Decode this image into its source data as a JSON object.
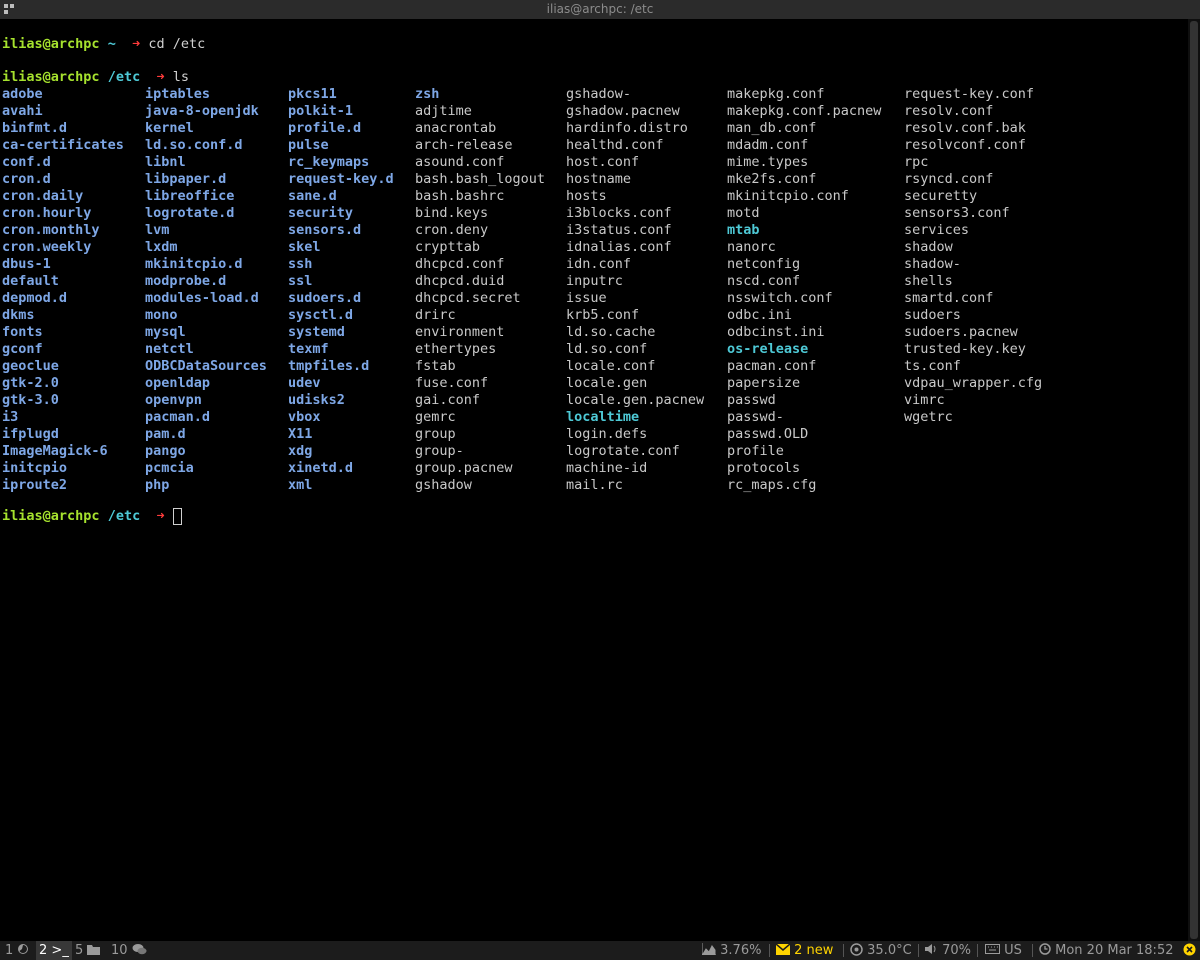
{
  "window": {
    "title": "ilias@archpc: /etc"
  },
  "terminal": {
    "prompts": [
      {
        "user": "ilias@archpc",
        "cwd": "~",
        "arrow": "➜",
        "command": "cd /etc"
      },
      {
        "user": "ilias@archpc",
        "cwd": "/etc",
        "arrow": "➜",
        "command": "ls"
      },
      {
        "user": "ilias@archpc",
        "cwd": "/etc",
        "arrow": "➜",
        "command": ""
      }
    ],
    "ls_columns": [
      {
        "entries": [
          {
            "name": "adobe",
            "type": "dir"
          },
          {
            "name": "avahi",
            "type": "dir"
          },
          {
            "name": "binfmt.d",
            "type": "dir"
          },
          {
            "name": "ca-certificates",
            "type": "dir"
          },
          {
            "name": "conf.d",
            "type": "dir"
          },
          {
            "name": "cron.d",
            "type": "dir"
          },
          {
            "name": "cron.daily",
            "type": "dir"
          },
          {
            "name": "cron.hourly",
            "type": "dir"
          },
          {
            "name": "cron.monthly",
            "type": "dir"
          },
          {
            "name": "cron.weekly",
            "type": "dir"
          },
          {
            "name": "dbus-1",
            "type": "dir"
          },
          {
            "name": "default",
            "type": "dir"
          },
          {
            "name": "depmod.d",
            "type": "dir"
          },
          {
            "name": "dkms",
            "type": "dir"
          },
          {
            "name": "fonts",
            "type": "dir"
          },
          {
            "name": "gconf",
            "type": "dir"
          },
          {
            "name": "geoclue",
            "type": "dir"
          },
          {
            "name": "gtk-2.0",
            "type": "dir"
          },
          {
            "name": "gtk-3.0",
            "type": "dir"
          },
          {
            "name": "i3",
            "type": "dir"
          },
          {
            "name": "ifplugd",
            "type": "dir"
          },
          {
            "name": "ImageMagick-6",
            "type": "dir"
          },
          {
            "name": "initcpio",
            "type": "dir"
          },
          {
            "name": "iproute2",
            "type": "dir"
          }
        ]
      },
      {
        "entries": [
          {
            "name": "iptables",
            "type": "dir"
          },
          {
            "name": "java-8-openjdk",
            "type": "dir"
          },
          {
            "name": "kernel",
            "type": "dir"
          },
          {
            "name": "ld.so.conf.d",
            "type": "dir"
          },
          {
            "name": "libnl",
            "type": "dir"
          },
          {
            "name": "libpaper.d",
            "type": "dir"
          },
          {
            "name": "libreoffice",
            "type": "dir"
          },
          {
            "name": "logrotate.d",
            "type": "dir"
          },
          {
            "name": "lvm",
            "type": "dir"
          },
          {
            "name": "lxdm",
            "type": "dir"
          },
          {
            "name": "mkinitcpio.d",
            "type": "dir"
          },
          {
            "name": "modprobe.d",
            "type": "dir"
          },
          {
            "name": "modules-load.d",
            "type": "dir"
          },
          {
            "name": "mono",
            "type": "dir"
          },
          {
            "name": "mysql",
            "type": "dir"
          },
          {
            "name": "netctl",
            "type": "dir"
          },
          {
            "name": "ODBCDataSources",
            "type": "dir"
          },
          {
            "name": "openldap",
            "type": "dir"
          },
          {
            "name": "openvpn",
            "type": "dir"
          },
          {
            "name": "pacman.d",
            "type": "dir"
          },
          {
            "name": "pam.d",
            "type": "dir"
          },
          {
            "name": "pango",
            "type": "dir"
          },
          {
            "name": "pcmcia",
            "type": "dir"
          },
          {
            "name": "php",
            "type": "dir"
          }
        ]
      },
      {
        "entries": [
          {
            "name": "pkcs11",
            "type": "dir"
          },
          {
            "name": "polkit-1",
            "type": "dir"
          },
          {
            "name": "profile.d",
            "type": "dir"
          },
          {
            "name": "pulse",
            "type": "dir"
          },
          {
            "name": "rc_keymaps",
            "type": "dir"
          },
          {
            "name": "request-key.d",
            "type": "dir"
          },
          {
            "name": "sane.d",
            "type": "dir"
          },
          {
            "name": "security",
            "type": "dir"
          },
          {
            "name": "sensors.d",
            "type": "dir"
          },
          {
            "name": "skel",
            "type": "dir"
          },
          {
            "name": "ssh",
            "type": "dir"
          },
          {
            "name": "ssl",
            "type": "dir"
          },
          {
            "name": "sudoers.d",
            "type": "dir"
          },
          {
            "name": "sysctl.d",
            "type": "dir"
          },
          {
            "name": "systemd",
            "type": "dir"
          },
          {
            "name": "texmf",
            "type": "dir"
          },
          {
            "name": "tmpfiles.d",
            "type": "dir"
          },
          {
            "name": "udev",
            "type": "dir"
          },
          {
            "name": "udisks2",
            "type": "dir"
          },
          {
            "name": "vbox",
            "type": "dir"
          },
          {
            "name": "X11",
            "type": "dir"
          },
          {
            "name": "xdg",
            "type": "dir"
          },
          {
            "name": "xinetd.d",
            "type": "dir"
          },
          {
            "name": "xml",
            "type": "dir"
          }
        ]
      },
      {
        "entries": [
          {
            "name": "zsh",
            "type": "dir"
          },
          {
            "name": "adjtime",
            "type": "file"
          },
          {
            "name": "anacrontab",
            "type": "file"
          },
          {
            "name": "arch-release",
            "type": "file"
          },
          {
            "name": "asound.conf",
            "type": "file"
          },
          {
            "name": "bash.bash_logout",
            "type": "file"
          },
          {
            "name": "bash.bashrc",
            "type": "file"
          },
          {
            "name": "bind.keys",
            "type": "file"
          },
          {
            "name": "cron.deny",
            "type": "file"
          },
          {
            "name": "crypttab",
            "type": "file"
          },
          {
            "name": "dhcpcd.conf",
            "type": "file"
          },
          {
            "name": "dhcpcd.duid",
            "type": "file"
          },
          {
            "name": "dhcpcd.secret",
            "type": "file"
          },
          {
            "name": "drirc",
            "type": "file"
          },
          {
            "name": "environment",
            "type": "file"
          },
          {
            "name": "ethertypes",
            "type": "file"
          },
          {
            "name": "fstab",
            "type": "file"
          },
          {
            "name": "fuse.conf",
            "type": "file"
          },
          {
            "name": "gai.conf",
            "type": "file"
          },
          {
            "name": "gemrc",
            "type": "file"
          },
          {
            "name": "group",
            "type": "file"
          },
          {
            "name": "group-",
            "type": "file"
          },
          {
            "name": "group.pacnew",
            "type": "file"
          },
          {
            "name": "gshadow",
            "type": "file"
          }
        ]
      },
      {
        "entries": [
          {
            "name": "gshadow-",
            "type": "file"
          },
          {
            "name": "gshadow.pacnew",
            "type": "file"
          },
          {
            "name": "hardinfo.distro",
            "type": "file"
          },
          {
            "name": "healthd.conf",
            "type": "file"
          },
          {
            "name": "host.conf",
            "type": "file"
          },
          {
            "name": "hostname",
            "type": "file"
          },
          {
            "name": "hosts",
            "type": "file"
          },
          {
            "name": "i3blocks.conf",
            "type": "file"
          },
          {
            "name": "i3status.conf",
            "type": "file"
          },
          {
            "name": "idnalias.conf",
            "type": "file"
          },
          {
            "name": "idn.conf",
            "type": "file"
          },
          {
            "name": "inputrc",
            "type": "file"
          },
          {
            "name": "issue",
            "type": "file"
          },
          {
            "name": "krb5.conf",
            "type": "file"
          },
          {
            "name": "ld.so.cache",
            "type": "file"
          },
          {
            "name": "ld.so.conf",
            "type": "file"
          },
          {
            "name": "locale.conf",
            "type": "file"
          },
          {
            "name": "locale.gen",
            "type": "file"
          },
          {
            "name": "locale.gen.pacnew",
            "type": "file"
          },
          {
            "name": "localtime",
            "type": "link"
          },
          {
            "name": "login.defs",
            "type": "file"
          },
          {
            "name": "logrotate.conf",
            "type": "file"
          },
          {
            "name": "machine-id",
            "type": "file"
          },
          {
            "name": "mail.rc",
            "type": "file"
          }
        ]
      },
      {
        "entries": [
          {
            "name": "makepkg.conf",
            "type": "file"
          },
          {
            "name": "makepkg.conf.pacnew",
            "type": "file"
          },
          {
            "name": "man_db.conf",
            "type": "file"
          },
          {
            "name": "mdadm.conf",
            "type": "file"
          },
          {
            "name": "mime.types",
            "type": "file"
          },
          {
            "name": "mke2fs.conf",
            "type": "file"
          },
          {
            "name": "mkinitcpio.conf",
            "type": "file"
          },
          {
            "name": "motd",
            "type": "file"
          },
          {
            "name": "mtab",
            "type": "link"
          },
          {
            "name": "nanorc",
            "type": "file"
          },
          {
            "name": "netconfig",
            "type": "file"
          },
          {
            "name": "nscd.conf",
            "type": "file"
          },
          {
            "name": "nsswitch.conf",
            "type": "file"
          },
          {
            "name": "odbc.ini",
            "type": "file"
          },
          {
            "name": "odbcinst.ini",
            "type": "file"
          },
          {
            "name": "os-release",
            "type": "link"
          },
          {
            "name": "pacman.conf",
            "type": "file"
          },
          {
            "name": "papersize",
            "type": "file"
          },
          {
            "name": "passwd",
            "type": "file"
          },
          {
            "name": "passwd-",
            "type": "file"
          },
          {
            "name": "passwd.OLD",
            "type": "file"
          },
          {
            "name": "profile",
            "type": "file"
          },
          {
            "name": "protocols",
            "type": "file"
          },
          {
            "name": "rc_maps.cfg",
            "type": "file"
          }
        ]
      },
      {
        "entries": [
          {
            "name": "request-key.conf",
            "type": "file"
          },
          {
            "name": "resolv.conf",
            "type": "file"
          },
          {
            "name": "resolv.conf.bak",
            "type": "file"
          },
          {
            "name": "resolvconf.conf",
            "type": "file"
          },
          {
            "name": "rpc",
            "type": "file"
          },
          {
            "name": "rsyncd.conf",
            "type": "file"
          },
          {
            "name": "securetty",
            "type": "file"
          },
          {
            "name": "sensors3.conf",
            "type": "file"
          },
          {
            "name": "services",
            "type": "file"
          },
          {
            "name": "shadow",
            "type": "file"
          },
          {
            "name": "shadow-",
            "type": "file"
          },
          {
            "name": "shells",
            "type": "file"
          },
          {
            "name": "smartd.conf",
            "type": "file"
          },
          {
            "name": "sudoers",
            "type": "file"
          },
          {
            "name": "sudoers.pacnew",
            "type": "file"
          },
          {
            "name": "trusted-key.key",
            "type": "file"
          },
          {
            "name": "ts.conf",
            "type": "file"
          },
          {
            "name": "vdpau_wrapper.cfg",
            "type": "file"
          },
          {
            "name": "vimrc",
            "type": "file"
          },
          {
            "name": "wgetrc",
            "type": "file"
          }
        ]
      }
    ]
  },
  "statusbar": {
    "workspaces": [
      {
        "number": "1",
        "icon": "firefox-icon",
        "active": false
      },
      {
        "number": "2",
        "icon": "terminal-icon",
        "active": true
      },
      {
        "number": "5",
        "icon": "folder-icon",
        "active": false
      },
      {
        "number": "10",
        "icon": "chat-icon",
        "active": false
      }
    ],
    "cpu_usage": "3.76%",
    "mail": "2 new",
    "temperature": "35.0°C",
    "volume": "70%",
    "keyboard_layout": "US",
    "datetime": "Mon 20 Mar 18:52",
    "colors": {
      "mail": "#ffd400",
      "user": "#a6e22e",
      "cwd": "#4ec9d6",
      "arrow": "#ff3b3b",
      "dir": "#7ea7e6"
    }
  }
}
